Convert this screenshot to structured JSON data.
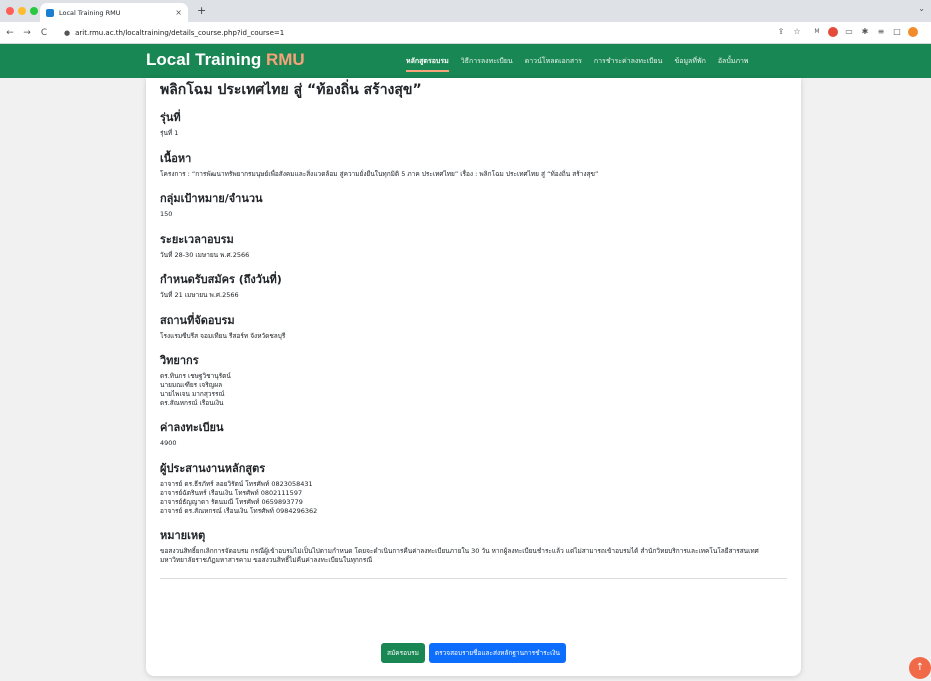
{
  "browser": {
    "tab_title": "Local Training RMU",
    "tab_close": "×",
    "new_tab": "+",
    "url": "arit.rmu.ac.th/localtraining/details_course.php?id_course=1"
  },
  "site": {
    "brand_main": "Local Training",
    "brand_accent": "RMU",
    "nav": [
      {
        "label": "หลักสูตรอบรม",
        "active": true
      },
      {
        "label": "วิธีการลงทะเบียน"
      },
      {
        "label": "ดาวน์โหลดเอกสาร"
      },
      {
        "label": "การชำระค่าลงทะเบียน"
      },
      {
        "label": "ข้อมูลที่พัก"
      },
      {
        "label": "อัลบั้มภาพ"
      }
    ],
    "colors": {
      "header": "#198754",
      "accent": "#f8a27a",
      "primary": "#0d6efd"
    }
  },
  "course": {
    "title": "พลิกโฉม ประเทศไทย สู่ “ท้องถิ่น สร้างสุข”",
    "batch_heading": "รุ่นที่",
    "batch_value": "รุ่นที่ 1",
    "content_heading": "เนื้อหา",
    "content_value": "โครงการ : “การพัฒนาทรัพยากรมนุษย์เพื่อสังคมและสิ่งแวดล้อม สู่ความยั่งยืนในทุกมิติ 5 ภาค ประเทศไทย” เรื่อง : พลิกโฉม ประเทศไทย สู่ “ท้องถิ่น สร้างสุข”",
    "target_heading": "กลุ่มเป้าหมาย/จำนวน",
    "target_value": "150",
    "duration_heading": "ระยะเวลาอบรม",
    "duration_value": "วันที่ 28-30 เมษายน พ.ศ.2566",
    "deadline_heading": "กำหนดรับสมัคร (ถึงวันที่)",
    "deadline_value": "วันที่ 21 เมษายน พ.ศ.2566",
    "venue_heading": "สถานที่จัดอบรม",
    "venue_value": "โรงแรมซีบรีส จอมเทียน รีสอร์ท จังหวัดชลบุรี",
    "speakers_heading": "วิทยากร",
    "speakers": [
      "ดร.ทินกร เชษฐวิชานุรัตน์",
      "นายมณเฑียร เจริญผล",
      "นายไพเจน มากสุวรรณ์",
      "ดร.สัณหกรณ์ เรือนเงิน"
    ],
    "fee_heading": "ค่าลงทะเบียน",
    "fee_value": "4900",
    "coordinator_heading": "ผู้ประสานงานหลักสูตร",
    "coordinators": [
      "อาจารย์ ดร.ธีรภัทร์ ลอยวิรัตน์ โทรศัพท์ 0823058431",
      "อาจารย์ฉัตรินทร์ เรือนเงิน โทรศัพท์ 0802111597",
      "อาจารย์ธัญญาดา รัตนมณี โทรศัพท์ 0659893779",
      "อาจารย์ ดร.สัณหกรณ์ เรือนเงิน โทรศัพท์ 0984296362"
    ],
    "note_heading": "หมายเหตุ",
    "note_value": "ขอสงวนสิทธิ์ยกเลิกการจัดอบรม กรณีผู้เข้าอบรมไม่เป็นไปตามกำหนด โดยจะดำเนินการคืนค่าลงทะเบียนภายใน 30 วัน หากผู้ลงทะเบียนชำระแล้ว แต่ไม่สามารถเข้าอบรมได้ สำนักวิทยบริการและเทคโนโลยีสารสนเทศ มหาวิทยาลัยราชภัฏมหาสารคาม ขอสงวนสิทธิ์ไม่คืนค่าลงทะเบียนในทุกกรณี"
  },
  "actions": {
    "register": "สมัครอบรม",
    "verify": "ตรวจสอบรายชื่อและส่งหลักฐานการชำระเงิน"
  },
  "icons": {
    "back": "←",
    "forward": "→",
    "reload": "C",
    "lock": "🔒",
    "share": "⇪",
    "star": "☆",
    "scroll_top": "↑",
    "chevron": "⌄"
  }
}
